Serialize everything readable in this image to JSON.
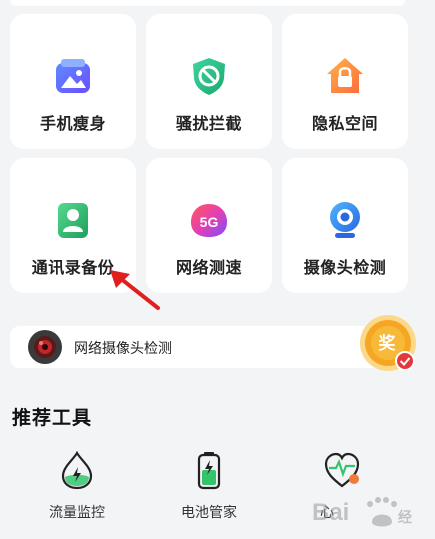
{
  "grid": {
    "tiles": [
      {
        "label": "手机瘦身",
        "icon": "photo-cleanup-icon"
      },
      {
        "label": "骚扰拦截",
        "icon": "block-shield-icon"
      },
      {
        "label": "隐私空间",
        "icon": "lock-house-icon"
      },
      {
        "label": "通讯录备份",
        "icon": "contact-backup-icon"
      },
      {
        "label": "网络测速",
        "icon": "5g-speed-icon"
      },
      {
        "label": "摄像头检测",
        "icon": "webcam-icon"
      }
    ]
  },
  "banner": {
    "text": "网络摄像头检测",
    "icon": "camera-lens-icon"
  },
  "medal": {
    "text": "奖",
    "icon": "reward-medal-icon",
    "check_icon": "check-badge-icon"
  },
  "recommended": {
    "title": "推荐工具",
    "tools": [
      {
        "label": "流量监控",
        "icon": "data-drop-icon"
      },
      {
        "label": "电池管家",
        "icon": "battery-icon"
      },
      {
        "label": "心",
        "icon": "heart-pulse-icon"
      }
    ]
  },
  "colors": {
    "background": "#f3f4f6",
    "card": "#ffffff",
    "arrow": "#e02020",
    "medal": "#f5a623"
  }
}
